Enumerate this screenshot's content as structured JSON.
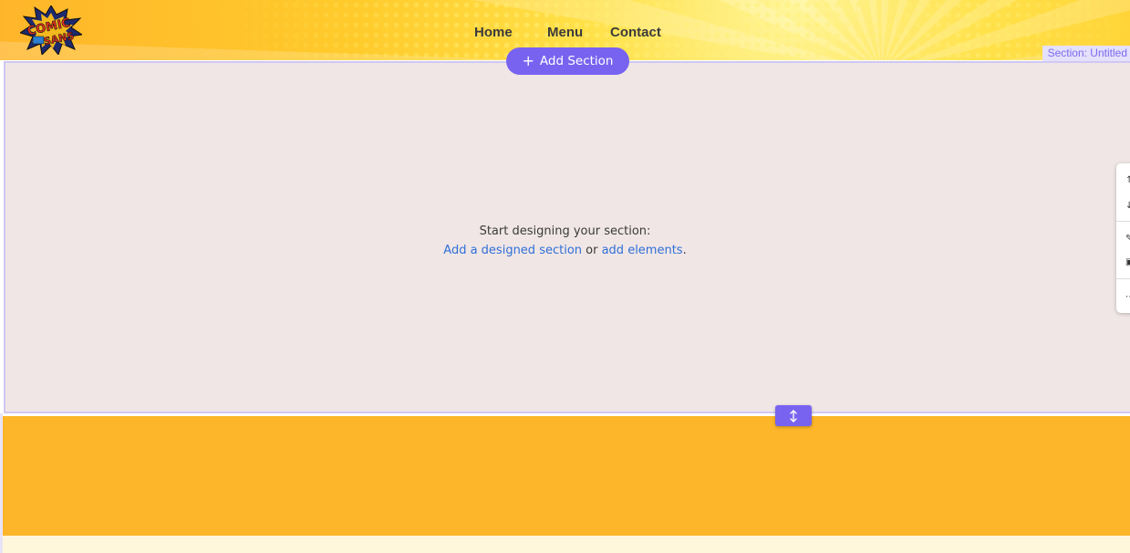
{
  "header": {
    "logo_alt": "Comic Sans logo",
    "nav": [
      "Home",
      "Menu",
      "Contact"
    ]
  },
  "section": {
    "tag": "Section: Untitled",
    "add_section_label": "Add Section",
    "empty_line1": "Start designing your section:",
    "link_designed": "Add a designed section",
    "or_text": " or ",
    "link_elements": "add elements",
    "period": "."
  },
  "colors": {
    "accent": "#7863f0",
    "footer": "#fdb629",
    "section_bg": "#f0e6e6",
    "link": "#2f6fd6"
  }
}
